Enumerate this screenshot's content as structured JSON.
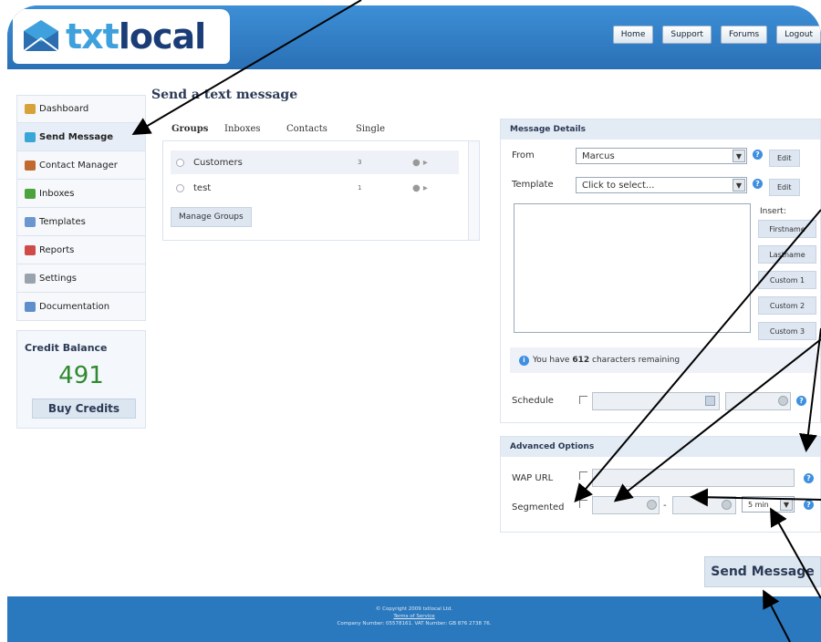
{
  "app": {
    "brand_prefix": "txt",
    "brand_suffix": "local"
  },
  "topnav": [
    "Home",
    "Support",
    "Forums",
    "Logout"
  ],
  "sidebar": {
    "items": [
      {
        "label": "Dashboard",
        "icon": "house-icon",
        "color": "#d7a23a"
      },
      {
        "label": "Send Message",
        "icon": "send-message-icon",
        "color": "#3aa6d7",
        "active": true
      },
      {
        "label": "Contact Manager",
        "icon": "contacts-icon",
        "color": "#c06a2f"
      },
      {
        "label": "Inboxes",
        "icon": "inbox-icon",
        "color": "#4aa33b"
      },
      {
        "label": "Templates",
        "icon": "template-icon",
        "color": "#6a97d0"
      },
      {
        "label": "Reports",
        "icon": "report-icon",
        "color": "#d04a4a"
      },
      {
        "label": "Settings",
        "icon": "wrench-icon",
        "color": "#9aa3ad"
      },
      {
        "label": "Documentation",
        "icon": "book-icon",
        "color": "#5f8fca"
      }
    ],
    "credit": {
      "title": "Credit Balance",
      "value": "491",
      "button": "Buy Credits"
    }
  },
  "main": {
    "title": "Send a text message",
    "tabs": [
      "Groups",
      "Inboxes",
      "Contacts",
      "Single"
    ],
    "active_tab": "Groups",
    "groups": [
      {
        "name": "Customers",
        "count": "3"
      },
      {
        "name": "test",
        "count": "1"
      }
    ],
    "manage_button": "Manage Groups"
  },
  "details": {
    "heading": "Message Details",
    "from_label": "From",
    "from_value": "Marcus",
    "template_label": "Template",
    "template_value": "Click to select...",
    "edit_label": "Edit",
    "insert_label": "Insert:",
    "insert_buttons": [
      "Firstname",
      "Lastname",
      "Custom 1",
      "Custom 2",
      "Custom 3"
    ],
    "remaining_prefix": "You have",
    "remaining_count": "612",
    "remaining_suffix": "characters remaining",
    "schedule_label": "Schedule"
  },
  "advanced": {
    "heading": "Advanced Options",
    "wap_label": "WAP URL",
    "segmented_label": "Segmented",
    "dash": "-",
    "interval_value": "5 min"
  },
  "send_button": "Send Message",
  "footer": {
    "copyright": "© Copyright 2009 txtlocal Ltd.",
    "terms": "Terms of Service",
    "company": "Company Number: 05578161. VAT Number: GB 876 2738 76."
  },
  "colors": {
    "header_blue": "#2a79bf",
    "credit_green": "#2e8a2e",
    "help_blue": "#3e8fe0"
  }
}
